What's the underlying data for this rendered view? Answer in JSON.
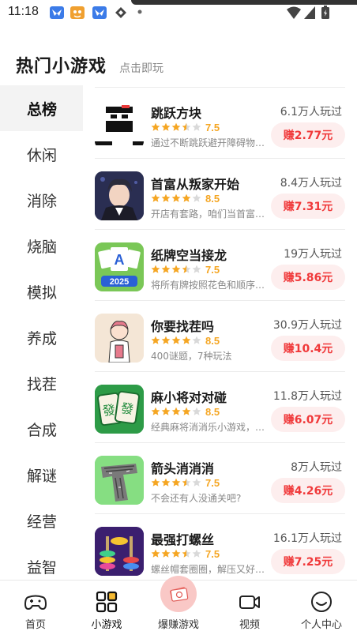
{
  "status_bar": {
    "time": "11:18"
  },
  "header": {
    "title": "热门小游戏",
    "subtitle": "点击即玩"
  },
  "sidebar": {
    "categories": [
      {
        "label": "总榜",
        "active": true
      },
      {
        "label": "休闲",
        "active": false
      },
      {
        "label": "消除",
        "active": false
      },
      {
        "label": "烧脑",
        "active": false
      },
      {
        "label": "模拟",
        "active": false
      },
      {
        "label": "养成",
        "active": false
      },
      {
        "label": "找茬",
        "active": false
      },
      {
        "label": "合成",
        "active": false
      },
      {
        "label": "解谜",
        "active": false
      },
      {
        "label": "经营",
        "active": false
      },
      {
        "label": "益智",
        "active": false
      }
    ]
  },
  "games": [
    {
      "name": "跳跃方块",
      "rating": "7.5",
      "stars": 3.5,
      "desc": "通过不断跳跃避开障碍物…",
      "plays": "6.1万人玩过",
      "earn": "赚2.77元",
      "icon": "ninja-block-icon"
    },
    {
      "name": "首富从叛家开始",
      "rating": "8.5",
      "stars": 4,
      "desc": "开店有套路，咱们当首富…",
      "plays": "8.4万人玩过",
      "earn": "赚7.31元",
      "icon": "businessman-portrait-icon"
    },
    {
      "name": "纸牌空当接龙",
      "rating": "7.5",
      "stars": 3.5,
      "desc": "将所有牌按照花色和顺序…",
      "plays": "19万人玩过",
      "earn": "赚5.86元",
      "icon": "solitaire-cards-icon"
    },
    {
      "name": "你要找茬吗",
      "rating": "8.5",
      "stars": 4,
      "desc": "400谜题，7种玩法",
      "plays": "30.9万人玩过",
      "earn": "赚10.4元",
      "icon": "cartoon-girl-icon"
    },
    {
      "name": "麻小将对对碰",
      "rating": "8.5",
      "stars": 4,
      "desc": "经典麻将消消乐小游戏，…",
      "plays": "11.8万人玩过",
      "earn": "赚6.07元",
      "icon": "mahjong-tile-icon"
    },
    {
      "name": "箭头消消消",
      "rating": "7.5",
      "stars": 3.5,
      "desc": "不会还有人没通关吧?",
      "plays": "8万人玩过",
      "earn": "赚4.26元",
      "icon": "arrow-puzzle-icon"
    },
    {
      "name": "最强打螺丝",
      "rating": "7.5",
      "stars": 3.5,
      "desc": "螺丝帽套圈圈，解压又好…",
      "plays": "16.1万人玩过",
      "earn": "赚7.25元",
      "icon": "screw-rings-icon"
    }
  ],
  "bottom_nav": {
    "items": [
      {
        "label": "首页",
        "icon": "gamepad-icon"
      },
      {
        "label": "小游戏",
        "icon": "grid-icon"
      },
      {
        "label": "爆赚游戏",
        "icon": "money-stack-icon"
      },
      {
        "label": "视频",
        "icon": "video-camera-icon"
      },
      {
        "label": "个人中心",
        "icon": "smiley-face-icon"
      }
    ]
  },
  "colors": {
    "accent_red": "#f0393a",
    "earn_bg": "#fdeeee",
    "star_gold": "#f5a623",
    "active_category_bg": "#f3f3f3"
  }
}
